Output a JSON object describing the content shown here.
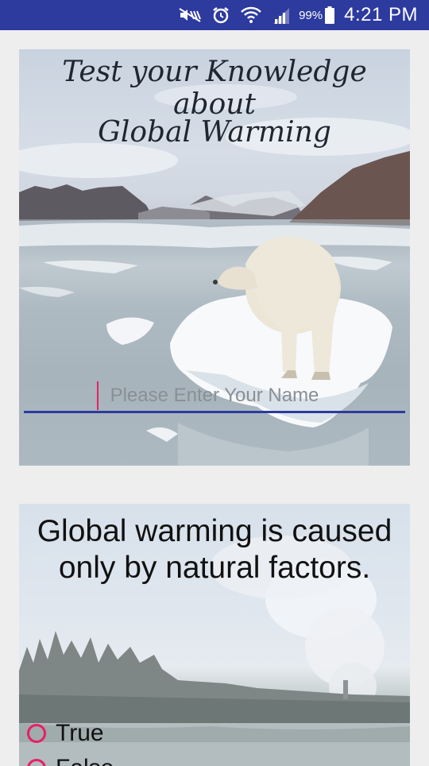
{
  "status_bar": {
    "battery_percent": "99%",
    "time": "4:21 PM",
    "icons": [
      "mute-icon",
      "alarm-icon",
      "wifi-icon",
      "signal-icon",
      "battery-icon"
    ]
  },
  "intro_card": {
    "title_line1": "Test your Knowledge about",
    "title_line2": "Global Warming",
    "name_input_placeholder": "Please Enter Your Name",
    "name_input_value": ""
  },
  "question_card": {
    "question": "Global warming is caused only by natural factors.",
    "options": [
      {
        "label": "True"
      },
      {
        "label": "False"
      }
    ]
  },
  "colors": {
    "status_bar": "#2d3a9e",
    "accent": "#e91e63",
    "input_underline": "#2d3a9e",
    "background": "#eeeeee"
  }
}
